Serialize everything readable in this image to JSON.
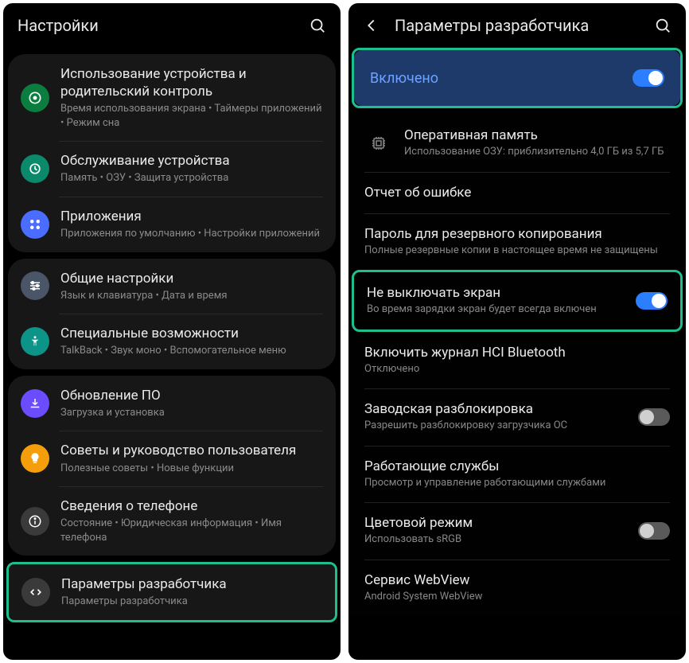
{
  "left": {
    "title": "Настройки",
    "groups": [
      [
        {
          "title": "Использование устройства и родительский контроль",
          "sub": "Время использования экрана  •  Таймеры приложений  •  Режим сна",
          "icon": "usage",
          "color": "ic-green"
        },
        {
          "title": "Обслуживание устройства",
          "sub": "Память  •  ОЗУ  •  Защита устройства",
          "icon": "care",
          "color": "ic-teal"
        },
        {
          "title": "Приложения",
          "sub": "Приложения по умолчанию  •  Настройки приложений",
          "icon": "apps",
          "color": "ic-blue"
        }
      ],
      [
        {
          "title": "Общие настройки",
          "sub": "Язык и клавиатура  •  Дата и время",
          "icon": "general",
          "color": "ic-gray"
        },
        {
          "title": "Специальные возможности",
          "sub": "TalkBack  •  Звук моно  •  Вспомогательное меню",
          "icon": "accessibility",
          "color": "ic-teal2"
        }
      ],
      [
        {
          "title": "Обновление ПО",
          "sub": "Загрузка и установка",
          "icon": "update",
          "color": "ic-purple"
        },
        {
          "title": "Советы и руководство пользователя",
          "sub": "Полезные советы  •  Новые функции",
          "icon": "tips",
          "color": "ic-orange"
        },
        {
          "title": "Сведения о телефоне",
          "sub": "Состояние  •  Юридическая информация  •  Имя телефона",
          "icon": "about",
          "color": "ic-dark"
        }
      ]
    ],
    "highlighted": {
      "title": "Параметры разработчика",
      "sub": "Параметры разработчика",
      "icon": "dev",
      "color": "ic-dark"
    }
  },
  "right": {
    "title": "Параметры разработчика",
    "enabled_label": "Включено",
    "items": [
      {
        "title": "Оперативная память",
        "sub": "Использование ОЗУ: приблизительно 4,0 ГБ из 5,7 ГБ",
        "icon": true
      },
      {
        "title": "Отчет об ошибке",
        "sub": ""
      },
      {
        "title": "Пароль для резервного копирования",
        "sub": "Полные резервные копии в настоящее время не защищены"
      },
      {
        "title": "Не выключать экран",
        "sub": "Во время зарядки экран будет всегда включен",
        "toggle": "on",
        "highlight": true
      },
      {
        "title": "Включить журнал HCI Bluetooth",
        "sub": "Отключено"
      },
      {
        "title": "Заводская разблокировка",
        "sub": "Разрешить разблокировку загрузчика ОС",
        "toggle": "off"
      },
      {
        "title": "Работающие службы",
        "sub": "Просмотр и управление работающими службами"
      },
      {
        "title": "Цветовой режим",
        "sub": "Использовать sRGB",
        "toggle": "off"
      },
      {
        "title": "Сервис WebView",
        "sub": "Android System WebView"
      }
    ]
  }
}
